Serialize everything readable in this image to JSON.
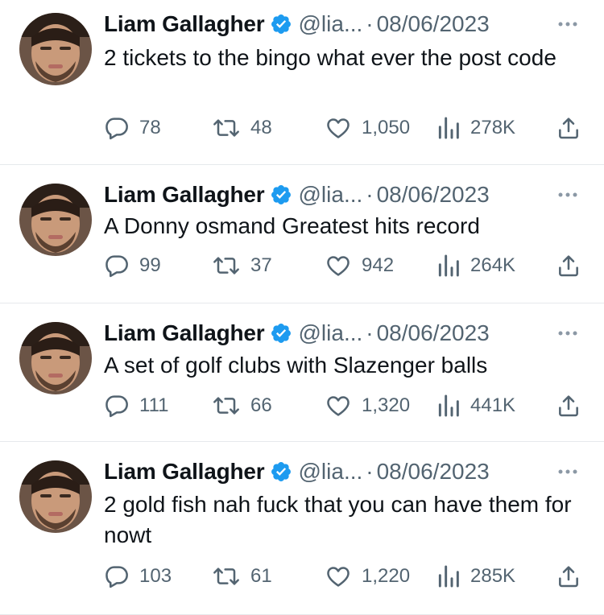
{
  "tweets": [
    {
      "name": "Liam Gallagher",
      "handle": "@lia...",
      "separator": "·",
      "date": "08/06/2023",
      "text": "2 tickets to the bingo what ever the post code",
      "replies": "78",
      "retweets": "48",
      "likes": "1,050",
      "views": "278K"
    },
    {
      "name": "Liam Gallagher",
      "handle": "@lia...",
      "separator": "·",
      "date": "08/06/2023",
      "text": "A Donny osmand Greatest hits record",
      "replies": "99",
      "retweets": "37",
      "likes": "942",
      "views": "264K"
    },
    {
      "name": "Liam Gallagher",
      "handle": "@lia...",
      "separator": "·",
      "date": "08/06/2023",
      "text": "A set of golf clubs with Slazenger balls",
      "replies": "111",
      "retweets": "66",
      "likes": "1,320",
      "views": "441K"
    },
    {
      "name": "Liam Gallagher",
      "handle": "@lia...",
      "separator": "·",
      "date": "08/06/2023",
      "text": "2 gold fish nah fuck that you can have them for nowt",
      "replies": "103",
      "retweets": "61",
      "likes": "1,220",
      "views": "285K"
    }
  ],
  "icons": {
    "verified": "verified-badge-icon",
    "more": "more-options-icon",
    "reply": "reply-icon",
    "retweet": "retweet-icon",
    "like": "like-icon",
    "views": "views-icon",
    "share": "share-icon"
  },
  "colors": {
    "verified": "#1d9bf0",
    "text": "#0f1419",
    "secondary": "#536471",
    "divider": "#e6e9ec"
  }
}
